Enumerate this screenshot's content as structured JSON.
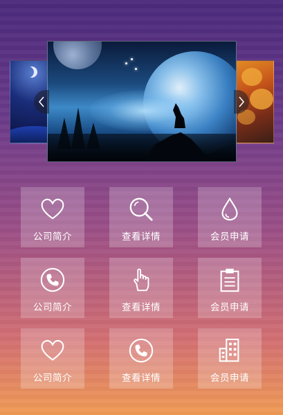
{
  "carousel": {
    "slides": [
      {
        "name": "night-moon-scene"
      },
      {
        "name": "wolf-planet-scene"
      },
      {
        "name": "autumn-forest-scene"
      }
    ],
    "prev_icon": "chevron-left-icon",
    "next_icon": "chevron-right-icon"
  },
  "tiles": [
    {
      "icon": "heart-icon",
      "label": "公司简介"
    },
    {
      "icon": "search-icon",
      "label": "查看详情"
    },
    {
      "icon": "water-drop-icon",
      "label": "会员申请"
    },
    {
      "icon": "phone-icon",
      "label": "公司简介"
    },
    {
      "icon": "pointer-hand-icon",
      "label": "查看详情"
    },
    {
      "icon": "clipboard-icon",
      "label": "会员申请"
    },
    {
      "icon": "heart-icon",
      "label": "公司简介"
    },
    {
      "icon": "phone-icon",
      "label": "查看详情"
    },
    {
      "icon": "buildings-icon",
      "label": "会员申请"
    }
  ],
  "colors": {
    "gradient_top": "#4b2a7c",
    "gradient_bottom": "#f09b55",
    "tile_bg": "rgba(255,255,255,0.22)",
    "text": "#ffffff"
  }
}
